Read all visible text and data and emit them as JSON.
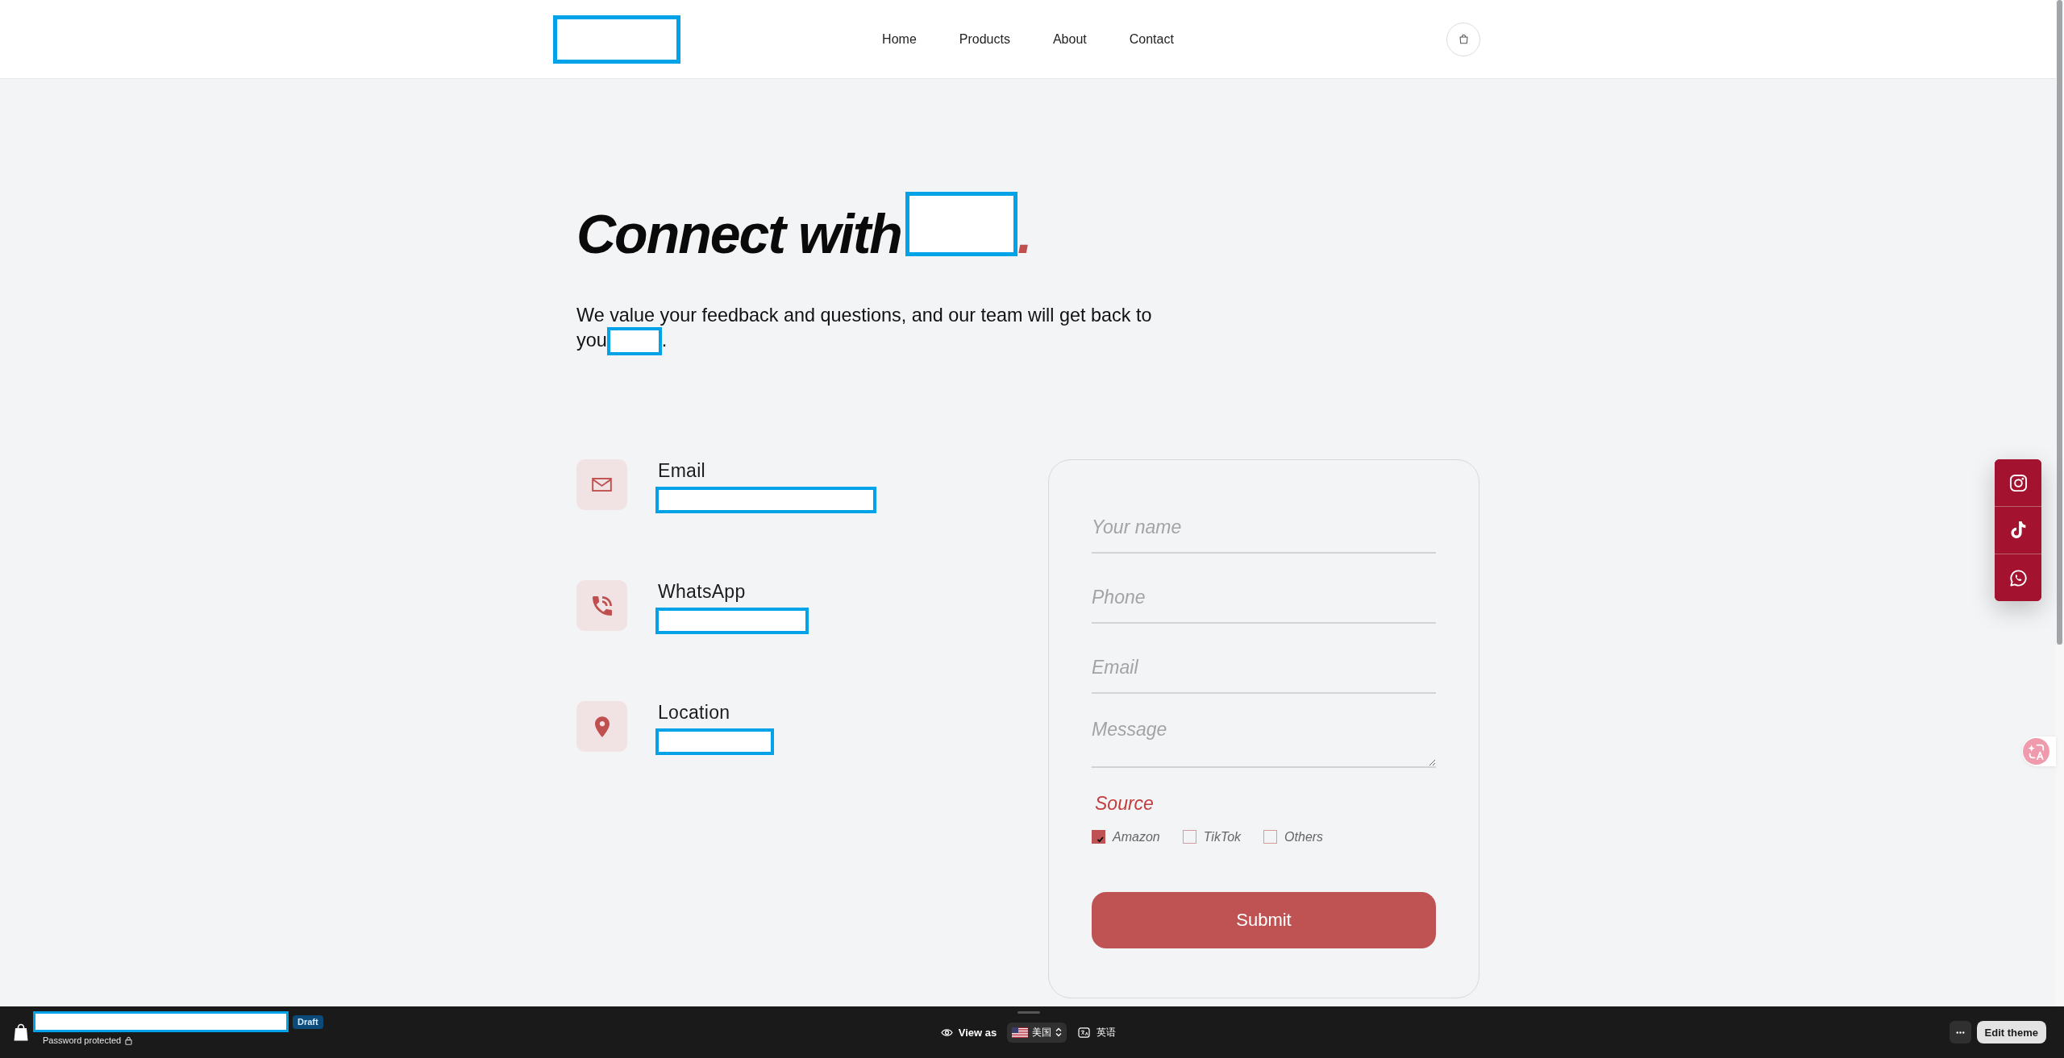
{
  "header": {
    "logo_redacted": true,
    "nav": [
      "Home",
      "Products",
      "About",
      "Contact"
    ]
  },
  "hero": {
    "title": "Connect with",
    "title_redacted": true,
    "title_end": ".",
    "intro": "We value your feedback and questions, and our team will get back to you",
    "intro_redacted": true,
    "intro_end": "."
  },
  "contacts": [
    {
      "kind": "email",
      "label": "Email",
      "value_redacted": true
    },
    {
      "kind": "phone",
      "label": "WhatsApp",
      "value_redacted": true
    },
    {
      "kind": "location",
      "label": "Location",
      "value_redacted": true
    }
  ],
  "form": {
    "fields": [
      {
        "kind": "input",
        "placeholder": "Your name"
      },
      {
        "kind": "input",
        "placeholder": "Phone"
      },
      {
        "kind": "input",
        "placeholder": "Email"
      },
      {
        "kind": "textarea",
        "placeholder": "Message"
      }
    ],
    "source": {
      "label": "Source",
      "options": [
        {
          "label": "Amazon",
          "checked": true
        },
        {
          "label": "TikTok",
          "checked": false
        },
        {
          "label": "Others",
          "checked": false
        }
      ]
    },
    "submit": "Submit"
  },
  "social_links": [
    {
      "kind": "instagram"
    },
    {
      "kind": "tiktok"
    },
    {
      "kind": "whatsapp"
    }
  ],
  "admin_bar": {
    "store_name_redacted": true,
    "status_badge": "Draft",
    "password_note": "Password protected",
    "view_as": "View as",
    "country": "美国",
    "language": "英语",
    "edit_button": "Edit theme"
  }
}
